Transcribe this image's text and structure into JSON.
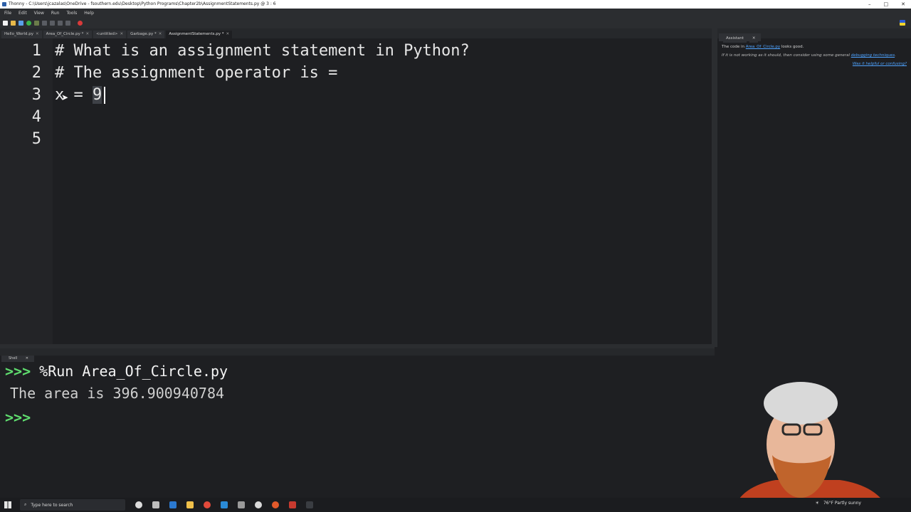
{
  "window": {
    "title": "Thonny  -  C:\\Users\\jcazalas\\OneDrive - fsouthern.edu\\Desktop\\Python Programs\\Chapter2b\\AssignmentStatements.py  @  3 : 6"
  },
  "menu": [
    "File",
    "Edit",
    "View",
    "Run",
    "Tools",
    "Help"
  ],
  "tabs": [
    {
      "label": "Hello_World.py"
    },
    {
      "label": "Area_Of_Circle.py *"
    },
    {
      "label": "<untitled>"
    },
    {
      "label": "Garbage.py *"
    },
    {
      "label": "AssignmentStatements.py *"
    }
  ],
  "editor": {
    "line_numbers": [
      "1",
      "2",
      "3",
      "4",
      "5"
    ],
    "lines": [
      "# What is an assignment statement in Python?",
      "# The assignment operator is =",
      "x = 9",
      "",
      ""
    ],
    "line3_prefix": "x = ",
    "line3_selected": "9"
  },
  "assistant": {
    "tab_label": "Assistant",
    "msg_prefix": "The code in ",
    "msg_link": "Area_Of_Circle.py",
    "msg_suffix": " looks good.",
    "hint_prefix": "If it is not working as it should, then consider using some general ",
    "hint_link": "debugging techniques",
    "hint_suffix": ".",
    "feedback_link": "Was it helpful or confusing?"
  },
  "shell": {
    "tab_label": "Shell",
    "prompt": ">>>",
    "command": "%Run Area_Of_Circle.py",
    "output": "The area is 396.900940784"
  },
  "taskbar": {
    "search_placeholder": "Type here to search",
    "weather": "76°F  Partly sunny"
  },
  "colors": {
    "prompt": "#5fdc6e",
    "link": "#4ea3ff",
    "background": "#1e1f22"
  }
}
